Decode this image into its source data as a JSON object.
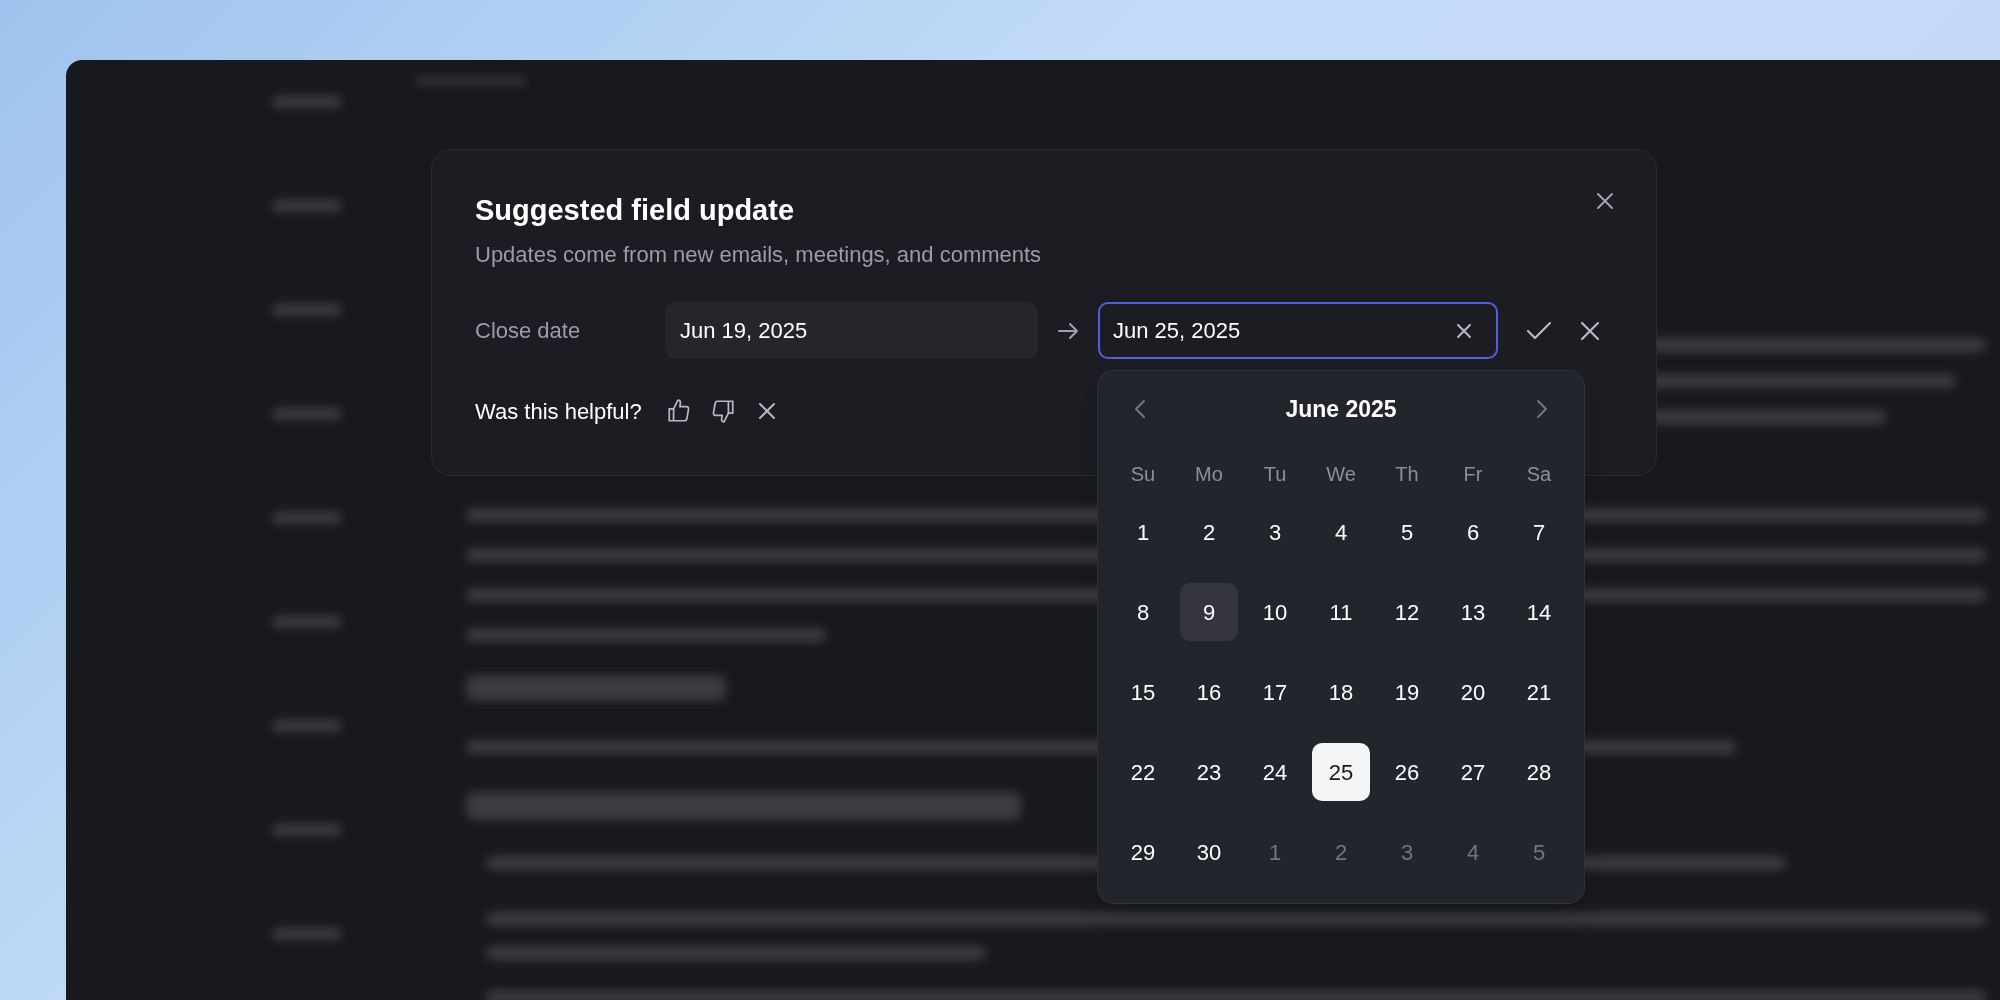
{
  "dialog": {
    "title": "Suggested field update",
    "subtitle": "Updates come from new emails, meetings, and comments",
    "field": {
      "label": "Close date",
      "current_value": "Jun 19, 2025",
      "suggested_value": "Jun 25, 2025"
    },
    "feedback": {
      "question": "Was this helpful?"
    }
  },
  "calendar": {
    "title": "June 2025",
    "weekdays": [
      "Su",
      "Mo",
      "Tu",
      "We",
      "Th",
      "Fr",
      "Sa"
    ],
    "days": [
      {
        "label": "1",
        "outside": false,
        "selected": false,
        "highlighted": false
      },
      {
        "label": "2",
        "outside": false,
        "selected": false,
        "highlighted": false
      },
      {
        "label": "3",
        "outside": false,
        "selected": false,
        "highlighted": false
      },
      {
        "label": "4",
        "outside": false,
        "selected": false,
        "highlighted": false
      },
      {
        "label": "5",
        "outside": false,
        "selected": false,
        "highlighted": false
      },
      {
        "label": "6",
        "outside": false,
        "selected": false,
        "highlighted": false
      },
      {
        "label": "7",
        "outside": false,
        "selected": false,
        "highlighted": false
      },
      {
        "label": "8",
        "outside": false,
        "selected": false,
        "highlighted": false
      },
      {
        "label": "9",
        "outside": false,
        "selected": false,
        "highlighted": true
      },
      {
        "label": "10",
        "outside": false,
        "selected": false,
        "highlighted": false
      },
      {
        "label": "11",
        "outside": false,
        "selected": false,
        "highlighted": false
      },
      {
        "label": "12",
        "outside": false,
        "selected": false,
        "highlighted": false
      },
      {
        "label": "13",
        "outside": false,
        "selected": false,
        "highlighted": false
      },
      {
        "label": "14",
        "outside": false,
        "selected": false,
        "highlighted": false
      },
      {
        "label": "15",
        "outside": false,
        "selected": false,
        "highlighted": false
      },
      {
        "label": "16",
        "outside": false,
        "selected": false,
        "highlighted": false
      },
      {
        "label": "17",
        "outside": false,
        "selected": false,
        "highlighted": false
      },
      {
        "label": "18",
        "outside": false,
        "selected": false,
        "highlighted": false
      },
      {
        "label": "19",
        "outside": false,
        "selected": false,
        "highlighted": false
      },
      {
        "label": "20",
        "outside": false,
        "selected": false,
        "highlighted": false
      },
      {
        "label": "21",
        "outside": false,
        "selected": false,
        "highlighted": false
      },
      {
        "label": "22",
        "outside": false,
        "selected": false,
        "highlighted": false
      },
      {
        "label": "23",
        "outside": false,
        "selected": false,
        "highlighted": false
      },
      {
        "label": "24",
        "outside": false,
        "selected": false,
        "highlighted": false
      },
      {
        "label": "25",
        "outside": false,
        "selected": true,
        "highlighted": false
      },
      {
        "label": "26",
        "outside": false,
        "selected": false,
        "highlighted": false
      },
      {
        "label": "27",
        "outside": false,
        "selected": false,
        "highlighted": false
      },
      {
        "label": "28",
        "outside": false,
        "selected": false,
        "highlighted": false
      },
      {
        "label": "29",
        "outside": false,
        "selected": false,
        "highlighted": false
      },
      {
        "label": "30",
        "outside": false,
        "selected": false,
        "highlighted": false
      },
      {
        "label": "1",
        "outside": true,
        "selected": false,
        "highlighted": false
      },
      {
        "label": "2",
        "outside": true,
        "selected": false,
        "highlighted": false
      },
      {
        "label": "3",
        "outside": true,
        "selected": false,
        "highlighted": false
      },
      {
        "label": "4",
        "outside": true,
        "selected": false,
        "highlighted": false
      },
      {
        "label": "5",
        "outside": true,
        "selected": false,
        "highlighted": false
      }
    ]
  }
}
